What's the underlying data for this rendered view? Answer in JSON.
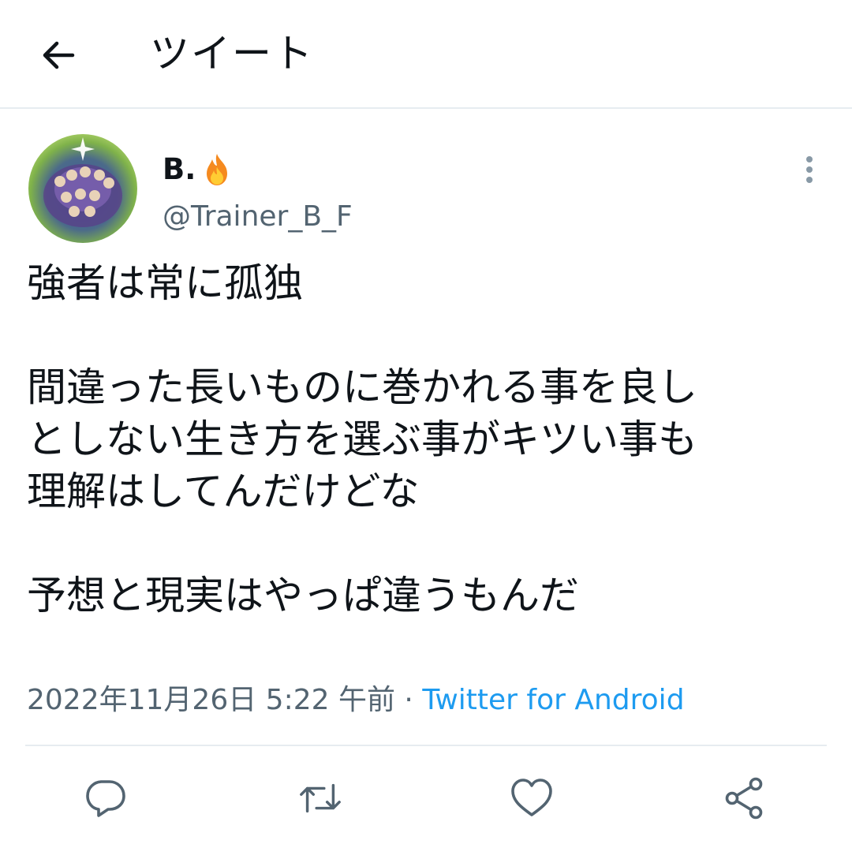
{
  "header": {
    "title": "ツイート",
    "back_icon": "arrow-left-icon"
  },
  "tweet": {
    "author_name": "B.",
    "author_emoji": "fire-icon",
    "handle": "@Trainer_B_F",
    "text": "強者は常に孤独\n\n間違った長いものに巻かれる事を良し\nとしない生き方を選ぶ事がキツい事も\n理解はしてんだけどな\n\n予想と現実はやっぱ違うもんだ",
    "timestamp": "2022年11月26日 5:22 午前",
    "separator": " · ",
    "source": "Twitter for Android"
  },
  "actions": [
    {
      "name": "reply",
      "icon": "reply-icon"
    },
    {
      "name": "retweet",
      "icon": "retweet-icon"
    },
    {
      "name": "like",
      "icon": "heart-icon"
    },
    {
      "name": "share",
      "icon": "share-icon"
    }
  ],
  "colors": {
    "text": "#0f1419",
    "secondary": "#536471",
    "link": "#1d9bf0",
    "divider": "#e6ecf0"
  }
}
